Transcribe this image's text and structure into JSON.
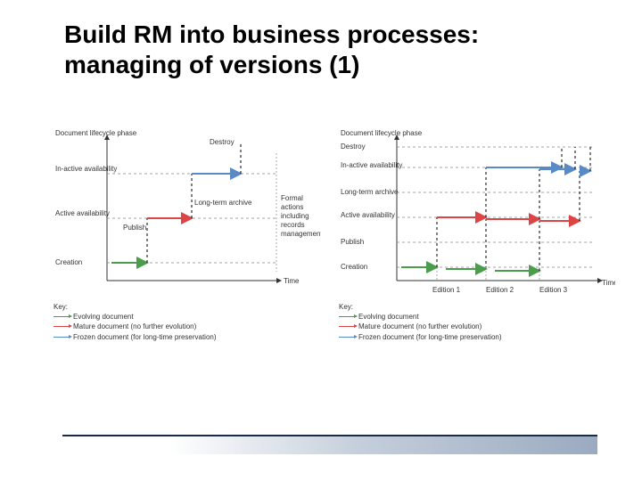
{
  "title": "Build RM into business processes: managing of versions (1)",
  "chart_data": [
    {
      "type": "diagram",
      "title": "",
      "ylabel": "Document lifecycle phase",
      "xlabel": "Time",
      "y_levels": [
        "Creation",
        "Active availability",
        "In-active availability"
      ],
      "annotations": [
        "Publish",
        "Long-term archive",
        "Destroy",
        "Formal actions including records management"
      ],
      "series": [
        {
          "name": "Evolving document",
          "color": "#4a9d4a"
        },
        {
          "name": "Mature document (no further evolution)",
          "color": "#d44"
        },
        {
          "name": "Frozen document (for long-time preservation)",
          "color": "#5a8ac6"
        }
      ]
    },
    {
      "type": "diagram",
      "title": "",
      "ylabel": "Document lifecycle phase",
      "xlabel": "Time",
      "x_ticks": [
        "Edition 1",
        "Edition 2",
        "Edition 3"
      ],
      "y_levels": [
        "Creation",
        "Publish",
        "Active availability",
        "Long-term archive",
        "In-active availability",
        "Destroy"
      ],
      "series": [
        {
          "name": "Evolving document",
          "color": "#4a9d4a"
        },
        {
          "name": "Mature document (no further evolution)",
          "color": "#d44"
        },
        {
          "name": "Frozen document (for long-time preservation)",
          "color": "#5a8ac6"
        }
      ]
    }
  ],
  "key": {
    "heading": "Key:",
    "items": [
      {
        "label": "Evolving document"
      },
      {
        "label": "Mature document (no further evolution)"
      },
      {
        "label": "Frozen document (for long-time preservation)"
      }
    ]
  }
}
